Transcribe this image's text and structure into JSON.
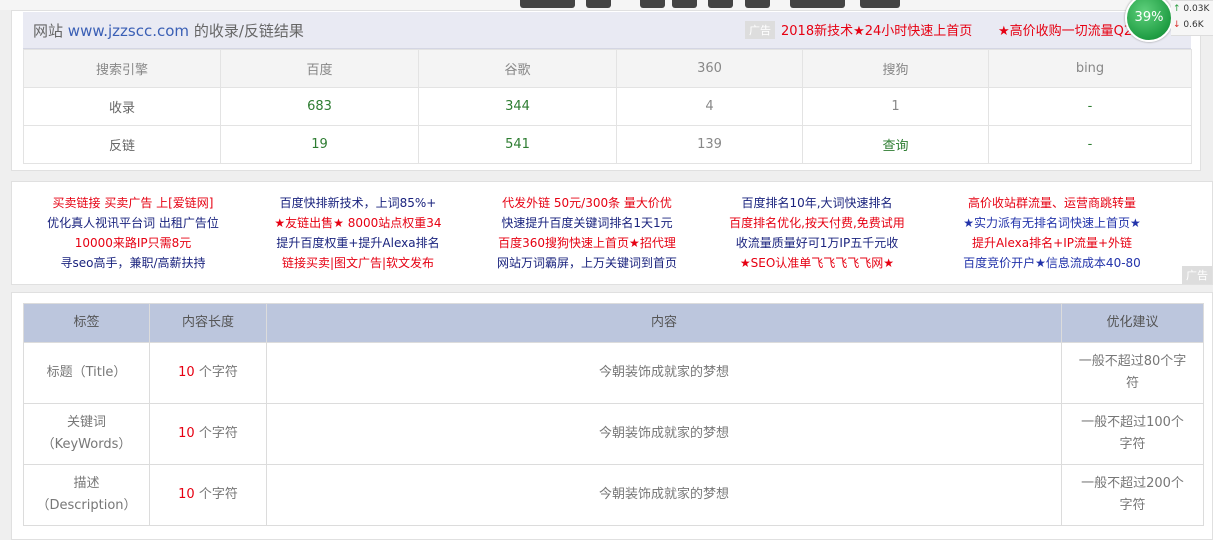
{
  "header": {
    "title_prefix": "网站",
    "domain": "www.jzzscc.com",
    "title_suffix": "的收录/反链结果",
    "ad_tag": "广告",
    "ad_links": [
      "2018新技术★24小时快速上首页",
      "★高价收购一切流量Q2"
    ]
  },
  "speed_widget": {
    "percent": "39%",
    "up_symbol": "↑",
    "up_rate": "0.03K",
    "down_symbol": "↓",
    "down_rate": "0.6K"
  },
  "stats_table": {
    "headers": [
      "搜索引擎",
      "百度",
      "谷歌",
      "360",
      "搜狗",
      "bing"
    ],
    "rows": [
      [
        "收录",
        "683",
        "344",
        "4",
        "1",
        "-"
      ],
      [
        "反链",
        "19",
        "541",
        "139",
        "查询",
        "-"
      ]
    ]
  },
  "ads_block": {
    "columns": [
      [
        "买卖链接 买卖广告 上[爱链网]",
        "优化真人视讯平台词 出租广告位",
        "10000来路IP只需8元",
        "寻seo高手，兼职/高薪扶持"
      ],
      [
        "百度快排新技术，上词85%+",
        "★友链出售★ 8000站点权重34",
        "提升百度权重+提升Alexa排名",
        "链接买卖|图文广告|软文发布"
      ],
      [
        "代发外链 50元/300条 量大价优",
        "快速提升百度关键词排名1天1元",
        "百度360搜狗快速上首页★招代理",
        "网站万词霸屏，上万关键词到首页"
      ],
      [
        "百度排名10年,大词快速排名",
        "百度排名优化,按天付费,免费试用",
        "收流量质量好可1万IP五千元收",
        "★SEO认准单飞飞飞飞飞网★"
      ],
      [
        "高价收站群流量、运营商跳转量",
        "★实力派有无排名词快速上首页★",
        "提升Alexa排名+IP流量+外链",
        "百度竞价开户★信息流成本40-80"
      ]
    ],
    "corner_tag": "广告"
  },
  "meta_table": {
    "headers": [
      "标签",
      "内容长度",
      "内容",
      "优化建议"
    ],
    "unit": "个字符",
    "rows": [
      {
        "label_line1": "标题（Title）",
        "label_line2": "",
        "length": "10",
        "content": "今朝装饰成就家的梦想",
        "advice_line1": "一般不超过80个字",
        "advice_line2": "符"
      },
      {
        "label_line1": "关键词",
        "label_line2": "（KeyWords）",
        "length": "10",
        "content": "今朝装饰成就家的梦想",
        "advice_line1": "一般不超过100个",
        "advice_line2": "字符"
      },
      {
        "label_line1": "描述",
        "label_line2": "（Description）",
        "length": "10",
        "content": "今朝装饰成就家的梦想",
        "advice_line1": "一般不超过200个",
        "advice_line2": "字符"
      }
    ]
  }
}
